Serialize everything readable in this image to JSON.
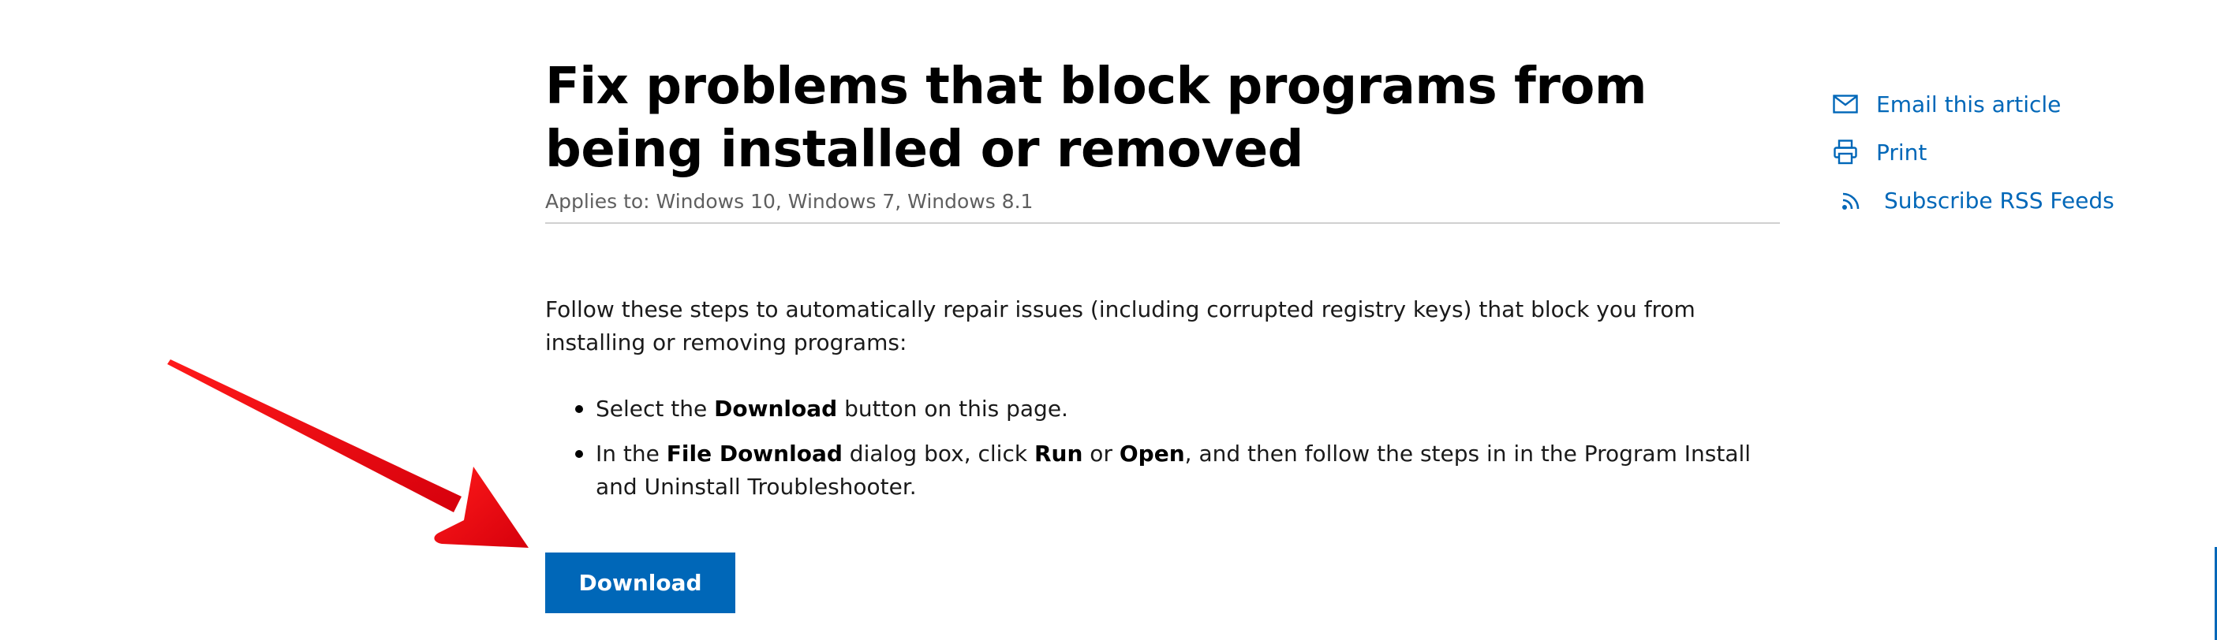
{
  "article": {
    "title": "Fix problems that block programs from being installed or removed",
    "applies_to": "Applies to: Windows 10, Windows 7, Windows 8.1",
    "intro": "Follow these steps to automatically repair issues (including corrupted registry keys) that block you from installing or removing programs:",
    "steps": [
      {
        "parts": [
          {
            "text": "Select the ",
            "bold": false
          },
          {
            "text": "Download",
            "bold": true
          },
          {
            "text": " button on this page.",
            "bold": false
          }
        ]
      },
      {
        "parts": [
          {
            "text": "In the ",
            "bold": false
          },
          {
            "text": "File Download",
            "bold": true
          },
          {
            "text": " dialog box, click ",
            "bold": false
          },
          {
            "text": "Run",
            "bold": true
          },
          {
            "text": " or ",
            "bold": false
          },
          {
            "text": "Open",
            "bold": true
          },
          {
            "text": ", and then follow the steps in in the Program Install and Uninstall Troubleshooter.",
            "bold": false
          }
        ]
      }
    ],
    "download_label": "Download"
  },
  "share": {
    "email_label": "Email this article",
    "email_icon": "envelope-icon",
    "print_label": "Print",
    "print_icon": "printer-icon",
    "rss_label": "Subscribe RSS Feeds",
    "rss_icon": "rss-icon"
  },
  "colors": {
    "accent": "#0067b8",
    "annotation_arrow": "#e8000e",
    "subtle_text": "#5f5f5f"
  }
}
